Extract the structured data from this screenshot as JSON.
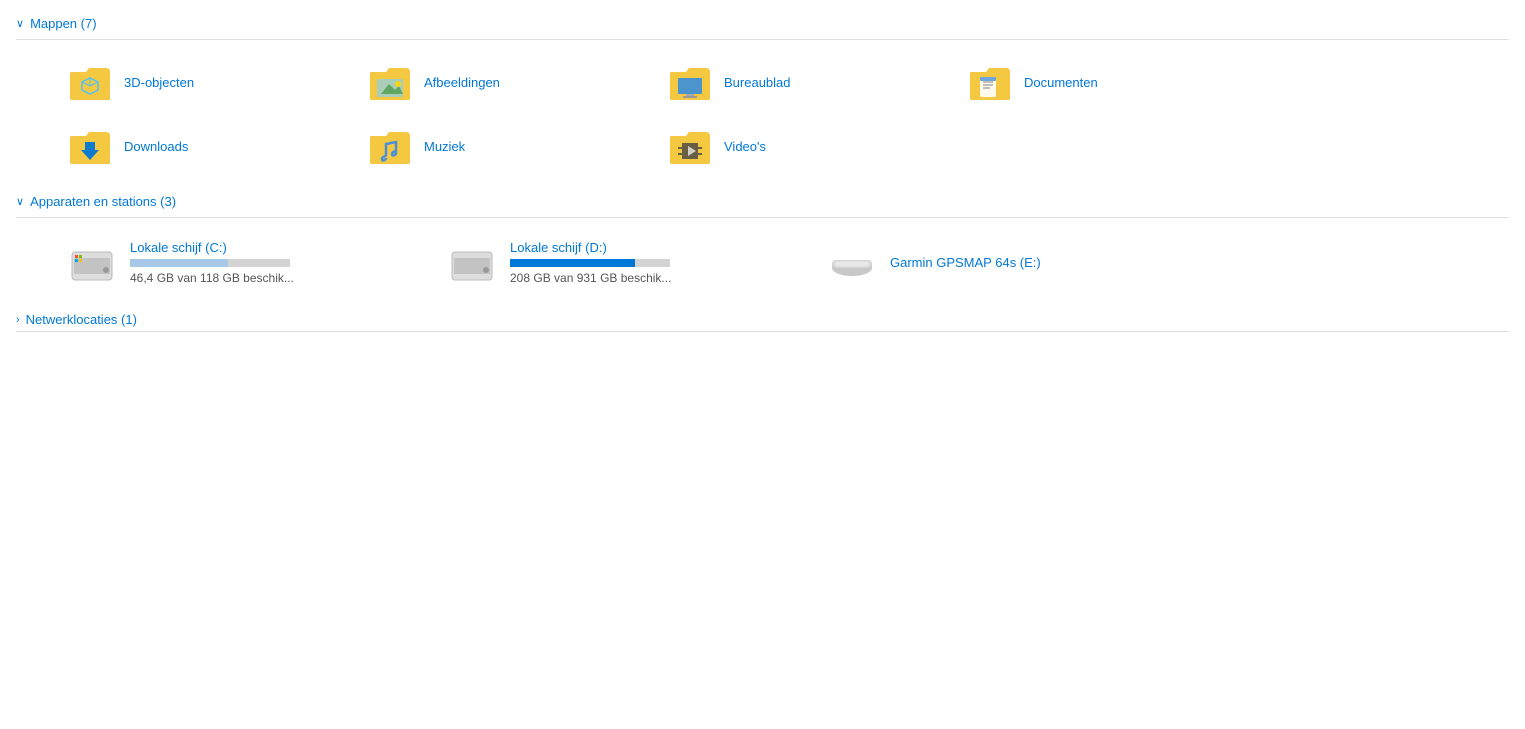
{
  "sections": {
    "folders": {
      "label": "Mappen (7)",
      "chevron": "∨",
      "items": [
        {
          "name": "3D-objecten",
          "icon": "3d-objects"
        },
        {
          "name": "Afbeeldingen",
          "icon": "pictures"
        },
        {
          "name": "Bureaublad",
          "icon": "desktop"
        },
        {
          "name": "Documenten",
          "icon": "documents"
        },
        {
          "name": "Downloads",
          "icon": "downloads"
        },
        {
          "name": "Muziek",
          "icon": "music"
        },
        {
          "name": "Video's",
          "icon": "videos"
        }
      ]
    },
    "devices": {
      "label": "Apparaten en stations (3)",
      "chevron": "∨",
      "items": [
        {
          "name": "Lokale schijf (C:)",
          "icon": "hdd-c",
          "used_pct": 61,
          "bar_color": "blue-light",
          "size_label": "46,4 GB van 118 GB beschik..."
        },
        {
          "name": "Lokale schijf (D:)",
          "icon": "hdd-d",
          "used_pct": 78,
          "bar_color": "blue-dark",
          "size_label": "208 GB van 931 GB beschik..."
        },
        {
          "name": "Garmin GPSMAP 64s (E:)",
          "icon": "usb-device",
          "used_pct": 0,
          "bar_color": "",
          "size_label": ""
        }
      ]
    },
    "network": {
      "label": "Netwerklocaties (1)",
      "chevron": ">"
    }
  }
}
